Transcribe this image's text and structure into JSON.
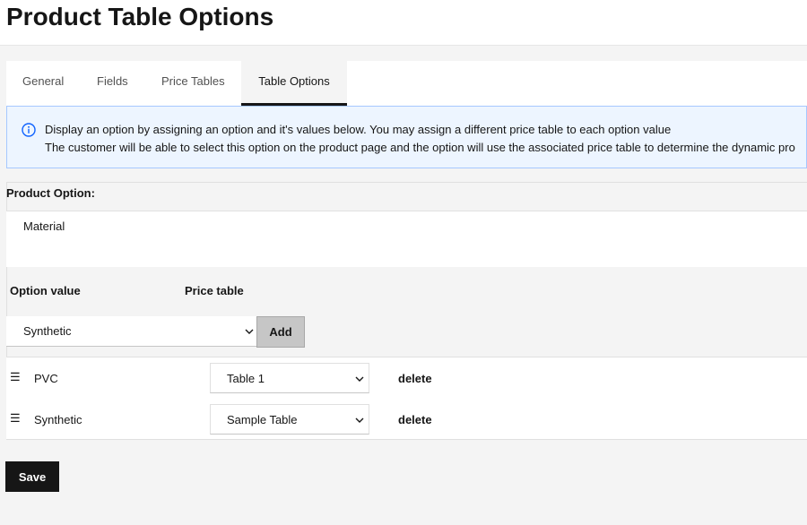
{
  "page": {
    "title": "Product Table Options"
  },
  "tabs": [
    {
      "label": "General"
    },
    {
      "label": "Fields"
    },
    {
      "label": "Price Tables"
    },
    {
      "label": "Table Options",
      "active": true
    }
  ],
  "info": {
    "icon": "info-icon",
    "line1": "Display an option by assigning an option and it's values below. You may assign a different price table to each option value",
    "line2": "The customer will be able to select this option on the product page and the option will use the associated price table to determine the dynamic pro"
  },
  "product_option": {
    "label": "Product Option:",
    "value": "Material"
  },
  "columns": {
    "option_value": "Option value",
    "price_table": "Price table"
  },
  "new_value": {
    "selected": "Synthetic",
    "add_label": "Add"
  },
  "rows": [
    {
      "option": "PVC",
      "table": "Table 1",
      "delete_label": "delete"
    },
    {
      "option": "Synthetic",
      "table": "Sample Table",
      "delete_label": "delete"
    }
  ],
  "save_label": "Save",
  "colors": {
    "accent": "#161616",
    "info_bg": "#edf5ff",
    "info_border": "#a6c8ff",
    "info_icon": "#0f62fe"
  }
}
